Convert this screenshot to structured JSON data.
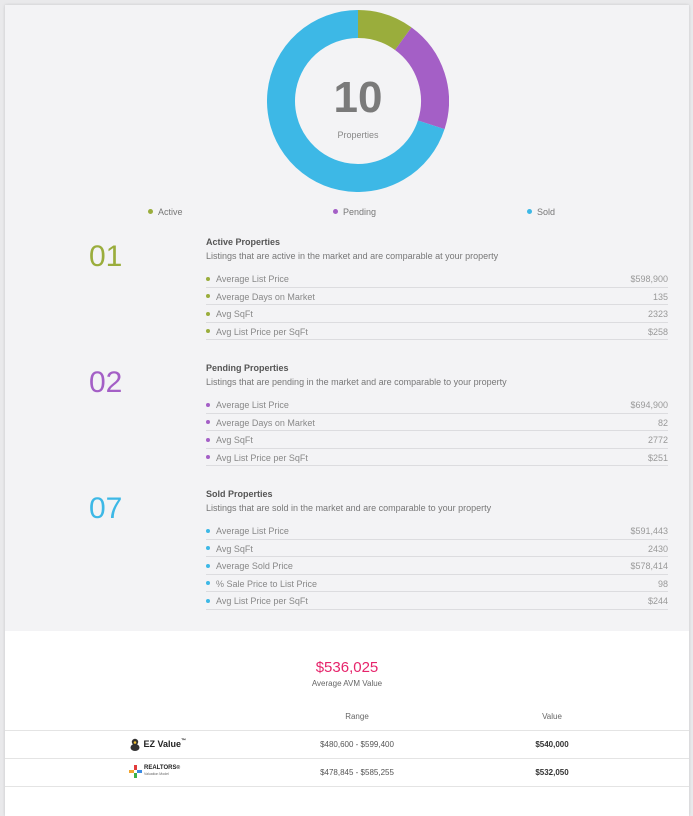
{
  "donut": {
    "count": "10",
    "label": "Properties",
    "segments": [
      {
        "name": "Active",
        "value": 1,
        "color": "#9aad3c"
      },
      {
        "name": "Pending",
        "value": 2,
        "color": "#a45fc6"
      },
      {
        "name": "Sold",
        "value": 7,
        "color": "#3db8e6"
      }
    ]
  },
  "legend": [
    {
      "label": "Active",
      "color": "#9aad3c"
    },
    {
      "label": "Pending",
      "color": "#a45fc6"
    },
    {
      "label": "Sold",
      "color": "#3db8e6"
    }
  ],
  "sections": [
    {
      "number": "01",
      "color": "#9aad3c",
      "title": "Active Properties",
      "desc": "Listings that are active in the market and are comparable at your property",
      "rows": [
        {
          "label": "Average List Price",
          "value": "$598,900"
        },
        {
          "label": "Average Days on Market",
          "value": "135"
        },
        {
          "label": "Avg SqFt",
          "value": "2323"
        },
        {
          "label": "Avg List Price per SqFt",
          "value": "$258"
        }
      ]
    },
    {
      "number": "02",
      "color": "#a45fc6",
      "title": "Pending Properties",
      "desc": "Listings that are pending in the market and are comparable to your property",
      "rows": [
        {
          "label": "Average List Price",
          "value": "$694,900"
        },
        {
          "label": "Average Days on Market",
          "value": "82"
        },
        {
          "label": "Avg SqFt",
          "value": "2772"
        },
        {
          "label": "Avg List Price per SqFt",
          "value": "$251"
        }
      ]
    },
    {
      "number": "07",
      "color": "#3db8e6",
      "title": "Sold Properties",
      "desc": "Listings that are sold in the market and are comparable to your property",
      "rows": [
        {
          "label": "Average List Price",
          "value": "$591,443"
        },
        {
          "label": "Avg SqFt",
          "value": "2430"
        },
        {
          "label": "Average Sold Price",
          "value": "$578,414"
        },
        {
          "label": "% Sale Price to List Price",
          "value": "98"
        },
        {
          "label": "Avg List Price per SqFt",
          "value": "$244"
        }
      ]
    }
  ],
  "avm": {
    "value": "$536,025",
    "label": "Average AVM Value",
    "headers": {
      "range": "Range",
      "value": "Value"
    },
    "rows": [
      {
        "provider": "EZ Value",
        "provider_sup": "™",
        "range": "$480,600 - $599,400",
        "value": "$540,000"
      },
      {
        "provider": "REALTORS",
        "provider_sup": "®",
        "provider_sub": "Valuation Model",
        "range": "$478,845 - $585,255",
        "value": "$532,050"
      }
    ]
  }
}
